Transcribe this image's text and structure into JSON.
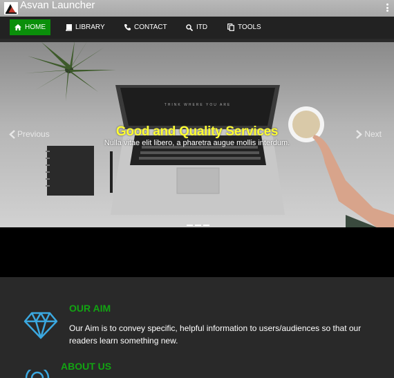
{
  "app": {
    "title": "Asvan Launcher"
  },
  "nav": {
    "items": [
      {
        "label": "HOME",
        "icon": "home-icon",
        "active": true
      },
      {
        "label": "LIBRARY",
        "icon": "book-icon"
      },
      {
        "label": "CONTACT",
        "icon": "phone-icon"
      },
      {
        "label": "ITD",
        "icon": "search-icon"
      },
      {
        "label": "TOOLS",
        "icon": "copy-icon"
      }
    ]
  },
  "carousel": {
    "title": "Good and Quality Services",
    "text": "Nulla vitae elit libero, a pharetra augue mollis interdum.",
    "prev_label": "Previous",
    "next_label": "Next"
  },
  "sections": [
    {
      "heading": "OUR AIM",
      "text": "Our Aim is to convey specific, helpful information to users/audiences so that our readers learn something new.",
      "icon": "diamond-icon"
    },
    {
      "heading": "ABOUT US",
      "icon": "about-icon"
    }
  ],
  "colors": {
    "accent_green": "#0a8f0a",
    "heading_green": "#12a412",
    "caption_yellow": "#ffff33",
    "icon_blue": "#3ba8e0",
    "navbar_bg": "#222222"
  }
}
